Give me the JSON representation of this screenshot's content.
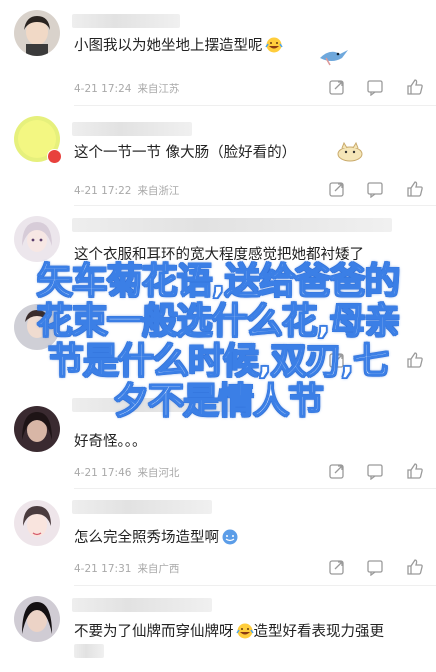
{
  "comments": [
    {
      "text": "小图我以为她坐地上摆造型呢",
      "emoji": "laugh-cry-emoji",
      "time": "4-21 17:24",
      "location": "来自江苏"
    },
    {
      "text": "这个一节一节 像大肠（脸好看的）",
      "emoji": "cat-sticker-emoji",
      "time": "4-21 17:22",
      "location": "来自浙江"
    },
    {
      "text": "这个衣服和耳环的宽大程度感觉把她都衬矮了",
      "emoji": "",
      "time": "",
      "location": ""
    },
    {
      "text": "",
      "emoji": "",
      "time": "",
      "location": ""
    },
    {
      "text": "好奇怪。。。",
      "emoji": "",
      "time": "4-21 17:46",
      "location": "来自河北"
    },
    {
      "text": "怎么完全照秀场造型啊",
      "emoji": "sweat-smile-emoji",
      "time": "4-21 17:31",
      "location": "来自广西"
    },
    {
      "text": "不要为了仙牌而穿仙牌呀",
      "text2": "造型好看表现力强更",
      "emoji": "laugh-cry-emoji",
      "time": "",
      "location": ""
    }
  ],
  "overlay": {
    "line1": "矢车菊花语,送给爸爸的",
    "line2": "花束一般选什么花,母亲",
    "line3": "节是什么时候,双刃,七",
    "line4": "夕不是情人节"
  },
  "colors": {
    "accent": "#3b7fe6",
    "badge": "#e8413d",
    "meta": "#a9a9a9"
  }
}
